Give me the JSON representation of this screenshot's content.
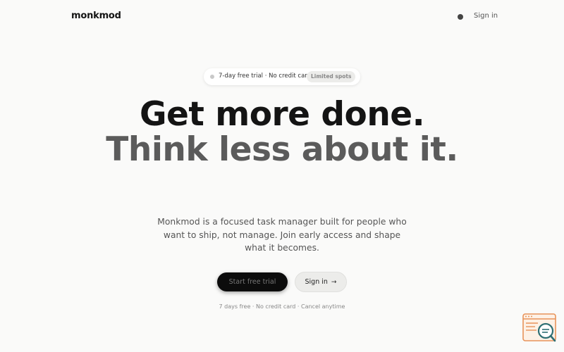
{
  "header": {
    "logo": "monkmod",
    "signin_label": "Sign in"
  },
  "badge": {
    "text": "7-day free trial · No credit card",
    "tag": "Limited spots"
  },
  "hero": {
    "headline_line1": "Get more done.",
    "headline_line2": "Think less about it.",
    "subtitle": "Monkmod is a focused task manager built for people who want to ship, not manage. Join early access and shape what it becomes.",
    "primary_cta": "Start free trial",
    "secondary_cta": "Sign in",
    "secondary_cta_icon": "arrow-right-icon",
    "fineprint": "7 days free · No credit card · Cancel anytime"
  },
  "widget": {
    "icon": "search-document-icon",
    "accent_color": "#e8935a",
    "secondary_color": "#2f6f73"
  },
  "colors": {
    "background": "#fafaf9",
    "primary_button": "#0c0c0c",
    "headline_dark": "#141414",
    "headline_muted": "#5b5b5b"
  }
}
